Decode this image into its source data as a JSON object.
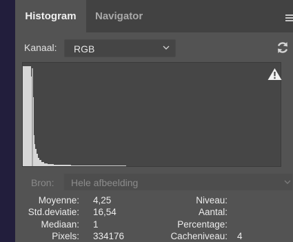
{
  "tabs": [
    {
      "label": "Histogram",
      "active": true
    },
    {
      "label": "Navigator",
      "active": false
    }
  ],
  "channel": {
    "label": "Kanaal:",
    "value": "RGB"
  },
  "source": {
    "label": "Bron:",
    "value": "Hele afbeelding"
  },
  "stats_left": [
    {
      "label": "Moyenne:",
      "value": "4,25"
    },
    {
      "label": "Std.deviatie:",
      "value": "16,54"
    },
    {
      "label": "Mediaan:",
      "value": "1"
    },
    {
      "label": "Pixels:",
      "value": "334176"
    }
  ],
  "stats_right": [
    {
      "label": "Niveau:",
      "value": ""
    },
    {
      "label": "Aantal:",
      "value": ""
    },
    {
      "label": "Percentage:",
      "value": ""
    },
    {
      "label": "Cacheniveau:",
      "value": "4"
    }
  ],
  "icons": {
    "menu": "panel-menu-icon",
    "refresh": "refresh-icon",
    "warning": "warning-icon",
    "dropdown": "chevron-down-icon"
  },
  "colors": {
    "panel_bg": "#535353",
    "tab_bar_bg": "#424242",
    "histogram_bg": "#464646",
    "histogram_fill": "#d6d6d6",
    "text": "#ececec"
  }
}
